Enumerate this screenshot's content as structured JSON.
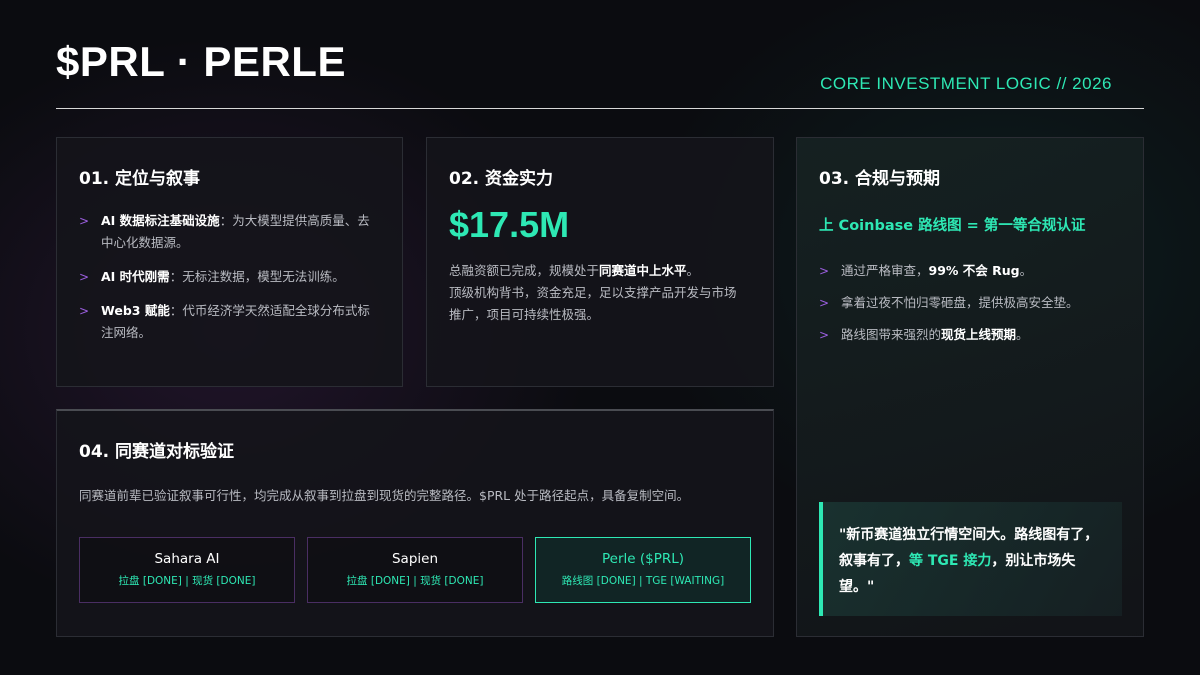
{
  "header": {
    "title": "$PRL · PERLE",
    "subtitle": "CORE INVESTMENT LOGIC // 2026"
  },
  "card1": {
    "title": "01. 定位与叙事",
    "items": [
      {
        "bold": "AI 数据标注基础设施",
        "text": "：为大模型提供高质量、去中心化数据源。"
      },
      {
        "bold": "AI 时代刚需",
        "text": "：无标注数据，模型无法训练。"
      },
      {
        "bold": "Web3 赋能",
        "text": "：代币经济学天然适配全球分布式标注网络。"
      }
    ]
  },
  "card2": {
    "title": "02. 资金实力",
    "amount": "$17.5M",
    "desc_pre": "总融资额已完成，规模处于",
    "desc_bold": "同赛道中上水平",
    "desc_post": "。",
    "desc_line2": "顶级机构背书，资金充足，足以支撑产品开发与市场推广，项目可持续性极强。"
  },
  "card3": {
    "title": "03. 合规与预期",
    "highlight": "上 Coinbase 路线图 = 第一等合规认证",
    "items": [
      {
        "pre": "通过严格审查，",
        "bold": "99% 不会 Rug",
        "post": "。"
      },
      {
        "pre": "拿着过夜不怕归零砸盘，提供极高安全垫。",
        "bold": "",
        "post": ""
      },
      {
        "pre": "路线图带来强烈的",
        "bold": "现货上线预期",
        "post": "。"
      }
    ],
    "quote_pre": "\"新币赛道独立行情空间大。路线图有了，叙事有了，",
    "quote_hl": "等 TGE 接力",
    "quote_post": "，别让市场失望。\""
  },
  "card4": {
    "title": "04. 同赛道对标验证",
    "desc": "同赛道前辈已验证叙事可行性，均完成从叙事到拉盘到现货的完整路径。$PRL 处于路径起点，具备复制空间。",
    "peers": [
      {
        "name": "Sahara AI",
        "status": "拉盘 [DONE] | 现货 [DONE]"
      },
      {
        "name": "Sapien",
        "status": "拉盘 [DONE] | 现货 [DONE]"
      },
      {
        "name": "Perle ($PRL)",
        "status": "路线图 [DONE] | TGE [WAITING]"
      }
    ]
  },
  "colors": {
    "accent": "#2ee8b4",
    "bullet": "#9c5fe0",
    "background": "#0b0c10"
  },
  "icons": {
    "bullet": "chevron-right-icon"
  }
}
